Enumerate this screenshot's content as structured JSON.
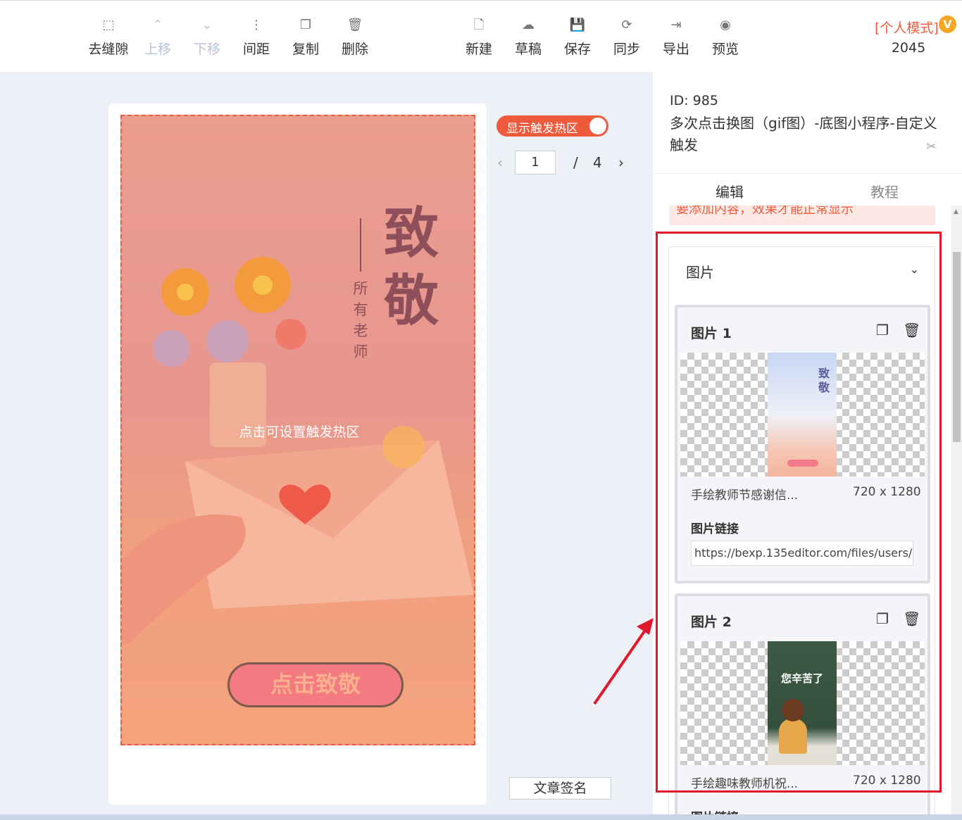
{
  "toolbar": {
    "left": [
      {
        "icon": "gap-icon",
        "glyph": "⬚",
        "label": "去缝隙",
        "disabled": false
      },
      {
        "icon": "arrow-up-icon",
        "glyph": "⌃",
        "label": "上移",
        "disabled": true
      },
      {
        "icon": "arrow-down-icon",
        "glyph": "⌄",
        "label": "下移",
        "disabled": true
      },
      {
        "icon": "spacing-icon",
        "glyph": "⋮",
        "label": "间距",
        "disabled": false
      },
      {
        "icon": "copy-icon",
        "glyph": "❐",
        "label": "复制",
        "disabled": false
      },
      {
        "icon": "trash-icon",
        "glyph": "🗑",
        "label": "删除",
        "disabled": false
      }
    ],
    "right": [
      {
        "icon": "new-file-icon",
        "glyph": "🗋",
        "label": "新建"
      },
      {
        "icon": "cloud-icon",
        "glyph": "☁",
        "label": "草稿"
      },
      {
        "icon": "save-icon",
        "glyph": "💾",
        "label": "保存"
      },
      {
        "icon": "sync-icon",
        "glyph": "⟳",
        "label": "同步"
      },
      {
        "icon": "export-icon",
        "glyph": "⇥",
        "label": "导出"
      },
      {
        "icon": "eye-icon",
        "glyph": "◉",
        "label": "预览"
      }
    ],
    "mode_label": "[个人模式]",
    "mode_badge": "V",
    "count": "2045"
  },
  "canvas": {
    "title_char_1": "致",
    "title_char_2": "敬",
    "vertical_text": "所有老师",
    "hotspot_hint": "点击可设置触发热区",
    "cta_label": "点击致敬"
  },
  "controls": {
    "toggle_label": "显示触发热区",
    "toggle_on": true,
    "page_current": "1",
    "page_sep": "/",
    "page_total": "4",
    "prev_glyph": "‹",
    "next_glyph": "›",
    "sign_label": "文章签名"
  },
  "panel": {
    "id_label": "ID: 985",
    "title": "多次点击换图（gif图）-底图小程序-自定义触发",
    "tabs": [
      "编辑",
      "教程"
    ],
    "warning": "要添加内容，效果才能正常显示",
    "section_title": "图片",
    "images": [
      {
        "title": "图片 1",
        "thumb_text": "致敬",
        "file_name": "手绘教师节感谢信...",
        "size": "720 x 1280",
        "link_label": "图片链接",
        "link_value": "https://bexp.135editor.com/files/users/0/"
      },
      {
        "title": "图片 2",
        "thumb_text": "您辛苦了",
        "file_name": "手绘趣味教师机祝...",
        "size": "720 x 1280",
        "link_label": "图片链接"
      }
    ]
  },
  "colors": {
    "accent": "#ef5a3c",
    "annotation_red": "#e0182a"
  }
}
